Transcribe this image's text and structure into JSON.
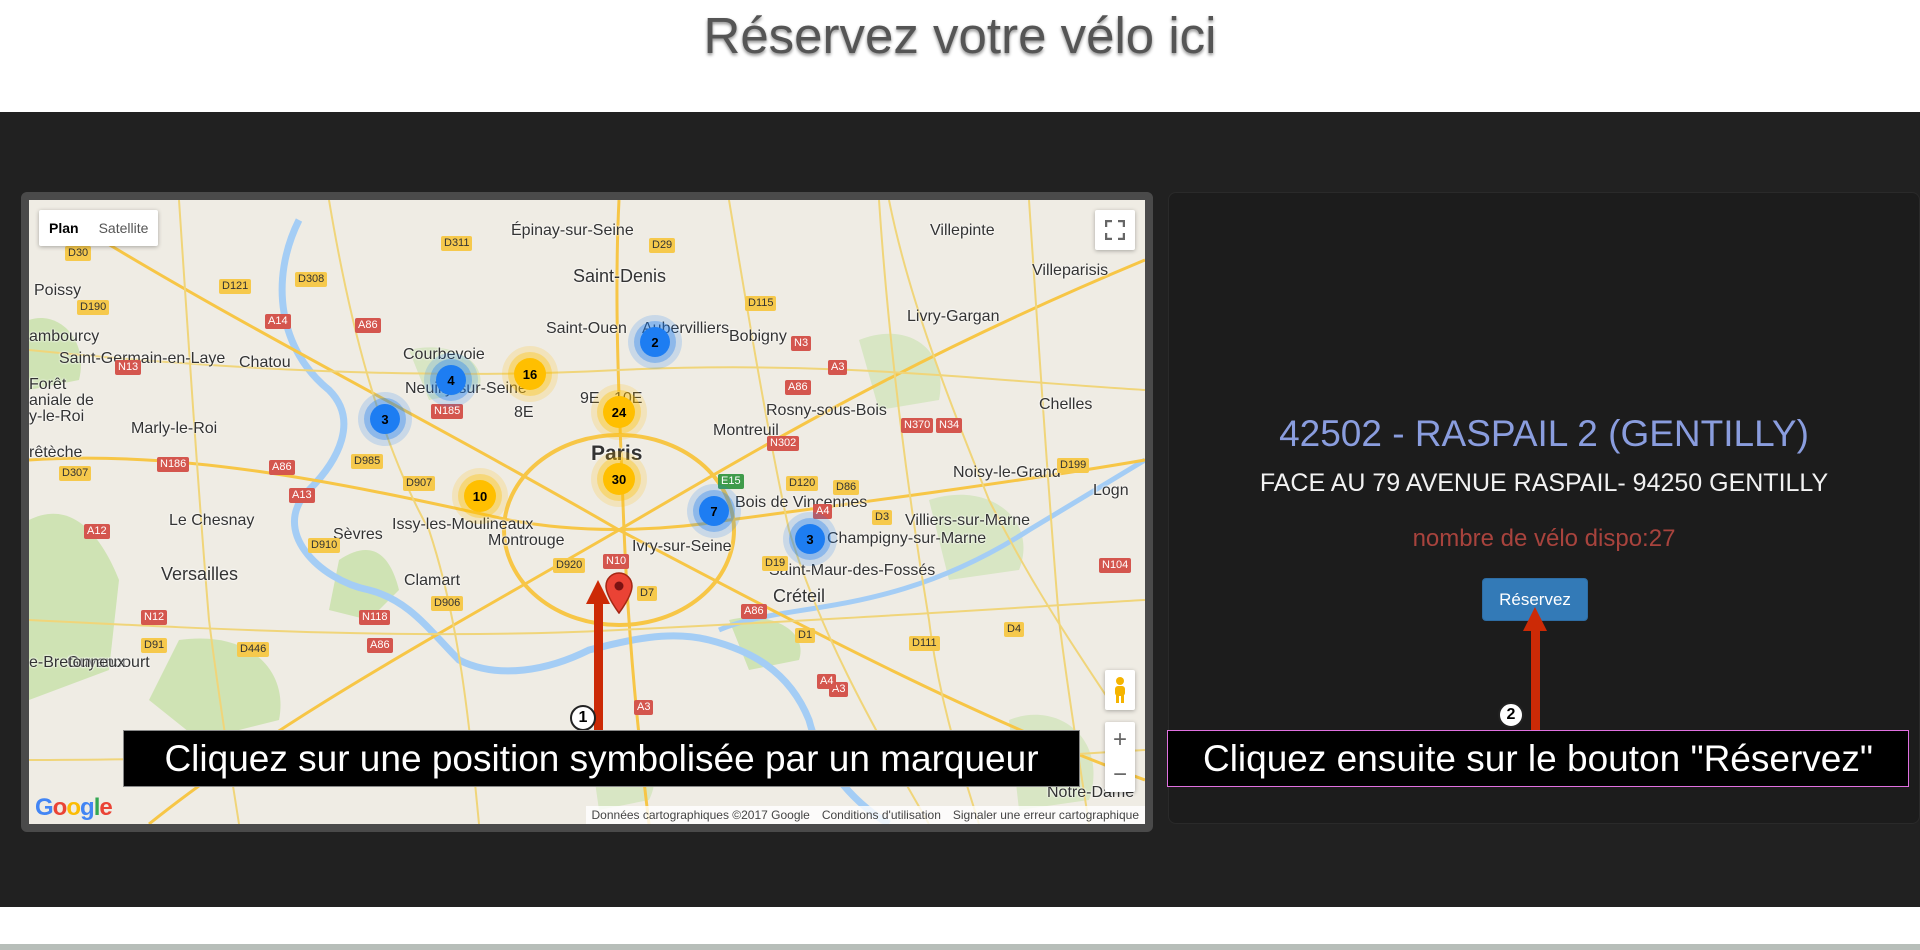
{
  "page": {
    "title": "Réservez votre vélo ici"
  },
  "map": {
    "map_type": {
      "plan": "Plan",
      "satellite": "Satellite"
    },
    "places": [
      {
        "label": "Épinay-sur-Seine",
        "size": "normal"
      },
      {
        "label": "Villepinte",
        "size": "normal"
      },
      {
        "label": "Saint-Denis",
        "size": "med"
      },
      {
        "label": "Villeparisis",
        "size": "normal"
      },
      {
        "label": "Poissy",
        "size": "normal"
      },
      {
        "label": "Livry-Gargan",
        "size": "normal"
      },
      {
        "label": "Saint-Ouen",
        "size": "normal"
      },
      {
        "label": "Aubervilliers",
        "size": "normal"
      },
      {
        "label": "Bobigny",
        "size": "normal"
      },
      {
        "label": "Courbevoie",
        "size": "normal"
      },
      {
        "label": "Saint-Germain-en-Laye",
        "size": "normal"
      },
      {
        "label": "Chatou",
        "size": "normal"
      },
      {
        "label": "Neuilly-sur-Seine",
        "size": "normal"
      },
      {
        "label": "Rosny-sous-Bois",
        "size": "normal"
      },
      {
        "label": "Chelles",
        "size": "normal"
      },
      {
        "label": "Marly-le-Roi",
        "size": "normal"
      },
      {
        "label": "Montreuil",
        "size": "normal"
      },
      {
        "label": "Paris",
        "size": "big"
      },
      {
        "label": "Noisy-le-Grand",
        "size": "normal"
      },
      {
        "label": "Le Chesnay",
        "size": "normal"
      },
      {
        "label": "Sèvres",
        "size": "normal"
      },
      {
        "label": "Issy-les-Moulineaux",
        "size": "normal"
      },
      {
        "label": "Villiers-sur-Marne",
        "size": "normal"
      },
      {
        "label": "Montrouge",
        "size": "normal"
      },
      {
        "label": "Ivry-sur-Seine",
        "size": "normal"
      },
      {
        "label": "Champigny-sur-Marne",
        "size": "normal"
      },
      {
        "label": "Versailles",
        "size": "med"
      },
      {
        "label": "Clamart",
        "size": "normal"
      },
      {
        "label": "Saint-Maur-des-Fossés",
        "size": "normal"
      },
      {
        "label": "Créteil",
        "size": "med"
      },
      {
        "label": "Bois de Vincennes",
        "size": "normal"
      },
      {
        "label": "Guyancourt",
        "size": "normal"
      },
      {
        "label": "Notre-Dame",
        "size": "normal"
      },
      {
        "label": "8E",
        "size": "normal"
      },
      {
        "label": "9E",
        "size": "normal"
      },
      {
        "label": "10E",
        "size": "normal"
      },
      {
        "label": "ambourcy",
        "size": "normal"
      },
      {
        "label": "rêtèche",
        "size": "normal"
      },
      {
        "label": "e-Bretonneux",
        "size": "normal"
      },
      {
        "label": "Logn",
        "size": "normal"
      },
      {
        "label": "Forêt",
        "size": "normal"
      },
      {
        "label": "aniale de",
        "size": "normal"
      },
      {
        "label": "y-le-Roi",
        "size": "normal"
      }
    ],
    "routes": [
      {
        "label": "D30",
        "c": "y"
      },
      {
        "label": "D311",
        "c": "y"
      },
      {
        "label": "D29",
        "c": "y"
      },
      {
        "label": "D308",
        "c": "y"
      },
      {
        "label": "D121",
        "c": "y"
      },
      {
        "label": "D190",
        "c": "y"
      },
      {
        "label": "A14",
        "c": "r"
      },
      {
        "label": "A86",
        "c": "r"
      },
      {
        "label": "D115",
        "c": "y"
      },
      {
        "label": "N13",
        "c": "r"
      },
      {
        "label": "N3",
        "c": "r"
      },
      {
        "label": "A3",
        "c": "r"
      },
      {
        "label": "N185",
        "c": "r"
      },
      {
        "label": "A86",
        "c": "r"
      },
      {
        "label": "N302",
        "c": "r"
      },
      {
        "label": "N370",
        "c": "r"
      },
      {
        "label": "N34",
        "c": "r"
      },
      {
        "label": "D307",
        "c": "y"
      },
      {
        "label": "N186",
        "c": "r"
      },
      {
        "label": "D985",
        "c": "y"
      },
      {
        "label": "D907",
        "c": "y"
      },
      {
        "label": "D199",
        "c": "y"
      },
      {
        "label": "E15",
        "c": "g"
      },
      {
        "label": "D120",
        "c": "y"
      },
      {
        "label": "D86",
        "c": "y"
      },
      {
        "label": "A13",
        "c": "r"
      },
      {
        "label": "A4",
        "c": "r"
      },
      {
        "label": "D3",
        "c": "y"
      },
      {
        "label": "A12",
        "c": "r"
      },
      {
        "label": "D910",
        "c": "y"
      },
      {
        "label": "D920",
        "c": "y"
      },
      {
        "label": "D19",
        "c": "y"
      },
      {
        "label": "N104",
        "c": "r"
      },
      {
        "label": "N10",
        "c": "r"
      },
      {
        "label": "D7",
        "c": "y"
      },
      {
        "label": "N12",
        "c": "r"
      },
      {
        "label": "D906",
        "c": "y"
      },
      {
        "label": "N118",
        "c": "r"
      },
      {
        "label": "D91",
        "c": "y"
      },
      {
        "label": "D446",
        "c": "y"
      },
      {
        "label": "A86",
        "c": "r"
      },
      {
        "label": "D111",
        "c": "y"
      },
      {
        "label": "D4",
        "c": "y"
      },
      {
        "label": "D1",
        "c": "y"
      },
      {
        "label": "A3",
        "c": "r"
      },
      {
        "label": "A3",
        "c": "r"
      },
      {
        "label": "A86",
        "c": "r"
      },
      {
        "label": "A4",
        "c": "r"
      },
      {
        "label": "A86",
        "c": "r"
      }
    ],
    "clusters": [
      {
        "count": "2",
        "color": "blue"
      },
      {
        "count": "4",
        "color": "blue"
      },
      {
        "count": "16",
        "color": "yellow"
      },
      {
        "count": "3",
        "color": "blue"
      },
      {
        "count": "24",
        "color": "yellow"
      },
      {
        "count": "30",
        "color": "yellow"
      },
      {
        "count": "10",
        "color": "yellow"
      },
      {
        "count": "7",
        "color": "blue"
      },
      {
        "count": "3",
        "color": "blue"
      }
    ],
    "zoom_in": "+",
    "zoom_out": "−",
    "fullscreen_icon": "fullscreen-icon",
    "google_logo": "Google",
    "footer": {
      "data": "Données cartographiques ©2017 Google",
      "terms": "Conditions d'utilisation",
      "report": "Signaler une erreur cartographique"
    }
  },
  "station": {
    "name": "42502 - RASPAIL 2 (GENTILLY)",
    "address": "FACE AU 79 AVENUE RASPAIL- 94250 GENTILLY",
    "bikes": "nombre de vélo dispo:27",
    "reserve_label": "Réservez"
  },
  "annotations": {
    "step1": {
      "number": "1",
      "text": "Cliquez sur une position symbolisée par un marqueur"
    },
    "step2": {
      "number": "2",
      "text": "Cliquez ensuite sur le bouton \"Réservez\""
    }
  },
  "colors": {
    "band": "#212121",
    "station_name": "#8a9dde",
    "bikes": "#a8433d",
    "button": "#337ab7",
    "arrow": "#cc2a06",
    "cluster_blue": "#1d7df2",
    "cluster_yellow": "#ffbf00"
  }
}
